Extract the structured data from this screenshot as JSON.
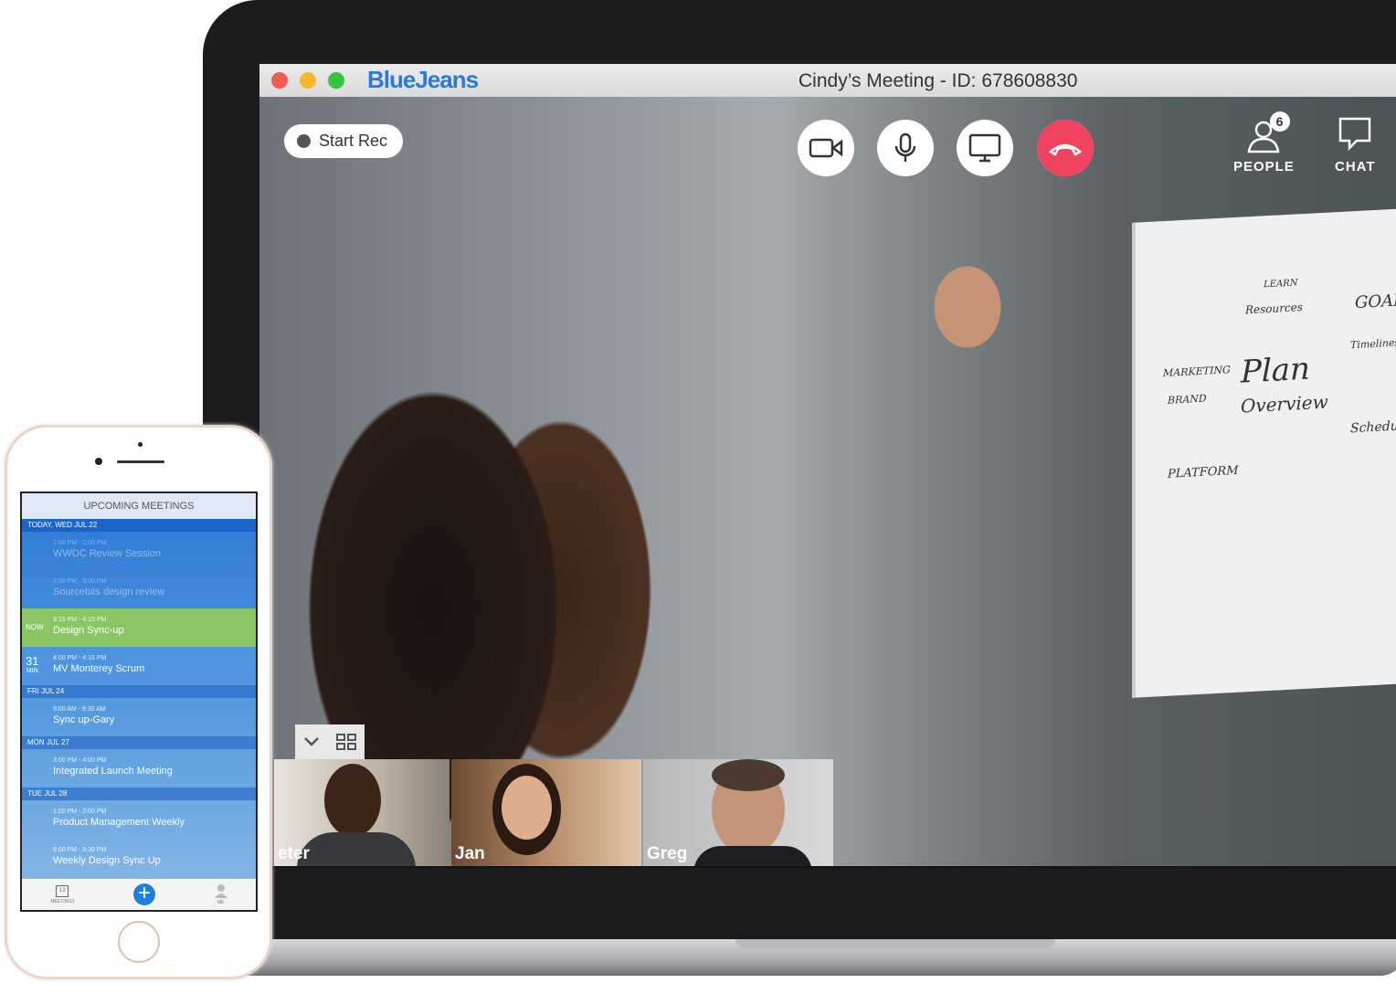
{
  "window": {
    "app_name": "BlueJeans",
    "title": "Cindy’s Meeting - ID: 678608830"
  },
  "toolbar": {
    "record_label": "Start Rec",
    "people_label": "PEOPLE",
    "people_count": "6",
    "chat_label": "CHAT",
    "end_call_color": "#f0435f"
  },
  "whiteboard": {
    "words": [
      "Plan",
      "Overview",
      "GOALS",
      "LEARN",
      "Resources",
      "MARKETING",
      "BRAND",
      "PLATFORM",
      "Schedule",
      "Timelines"
    ]
  },
  "participants": [
    {
      "name": "Peter"
    },
    {
      "name": "Jan"
    },
    {
      "name": "Greg"
    }
  ],
  "participants_visible": [
    "eter",
    "Jan",
    "Greg"
  ],
  "phone": {
    "header": "UPCOMING MEETINGS",
    "sections": [
      {
        "label": "TODAY, WED JUL 22",
        "meetings": [
          {
            "time": "1:00 PM - 2:00 PM",
            "name": "WWDC Review Session",
            "state": "past"
          },
          {
            "time": "2:00 PM - 3:00 PM",
            "name": "Sourcebits design review",
            "state": "past"
          },
          {
            "time": "3:15 PM - 4:15 PM",
            "name": "Design Sync-up",
            "state": "now",
            "left": "NOW"
          },
          {
            "time": "4:00 PM - 4:15 PM",
            "name": "MV Monterey Scrum",
            "state": "upcoming",
            "left": "31",
            "left_sub": "MIN"
          }
        ]
      },
      {
        "label": "FRI JUL 24",
        "meetings": [
          {
            "time": "9:00 AM - 9:30 AM",
            "name": "Sync up-Gary"
          }
        ]
      },
      {
        "label": "MON JUL 27",
        "meetings": [
          {
            "time": "3:00 PM - 4:00 PM",
            "name": "Integrated Launch Meeting"
          }
        ]
      },
      {
        "label": "TUE JUL 28",
        "meetings": [
          {
            "time": "1:00 PM - 2:00 PM",
            "name": "Product Management Weekly"
          },
          {
            "time": "9:00 PM - 9:30 PM",
            "name": "Weekly Design Sync Up"
          }
        ]
      }
    ],
    "tabs": {
      "meetings": "MEETINGS",
      "calendar_day": "13",
      "me": "ME"
    }
  }
}
